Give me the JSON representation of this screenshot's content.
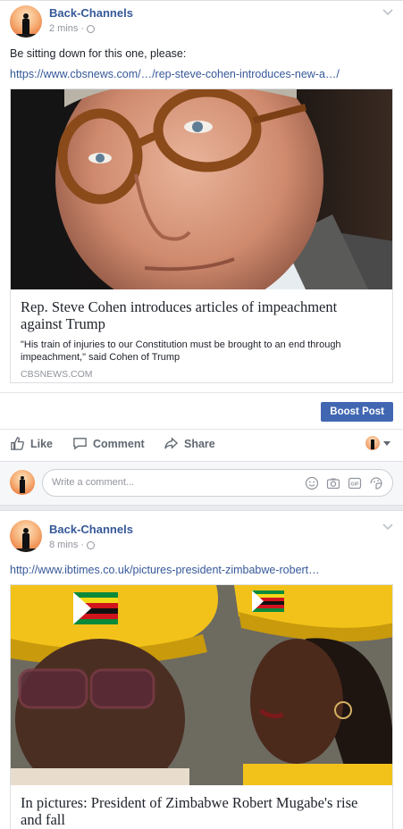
{
  "post1": {
    "page_name": "Back-Channels",
    "time": "2 mins",
    "text": "Be sitting down for this one, please:",
    "link": "https://www.cbsnews.com/…/rep-steve-cohen-introduces-new-a…/",
    "card": {
      "title": "Rep. Steve Cohen introduces articles of impeachment against Trump",
      "description": "\"His train of injuries to our Constitution must be brought to an end through impeachment,\" said Cohen of Trump",
      "domain": "CBSNEWS.COM"
    },
    "boost_label": "Boost Post",
    "actions": {
      "like": "Like",
      "comment": "Comment",
      "share": "Share"
    },
    "comment_placeholder": "Write a comment..."
  },
  "post2": {
    "page_name": "Back-Channels",
    "time": "8 mins",
    "link": "http://www.ibtimes.co.uk/pictures-president-zimbabwe-robert…",
    "card": {
      "title": "In pictures: President of Zimbabwe Robert Mugabe's rise and fall"
    }
  },
  "colors": {
    "brand_blue": "#4267b2",
    "link_blue": "#365899",
    "meta_grey": "#90949c"
  },
  "icons": [
    "globe-icon",
    "chevron-down-icon",
    "like-icon",
    "comment-icon",
    "share-icon",
    "emoji-icon",
    "camera-icon",
    "gif-icon",
    "sticker-icon"
  ]
}
